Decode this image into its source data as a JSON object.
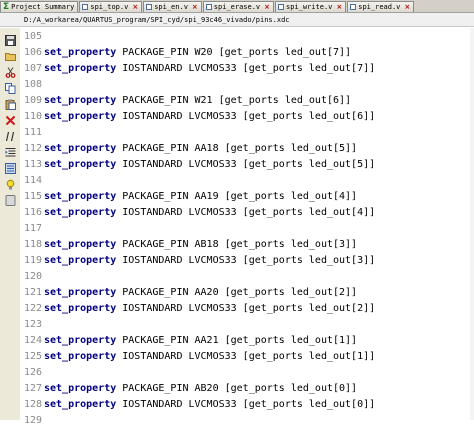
{
  "tabs": [
    {
      "label": "Project Summary",
      "icon": "sigma-icon"
    },
    {
      "label": "spi_top.v",
      "icon": "verilog-file-icon"
    },
    {
      "label": "spi_en.v",
      "icon": "verilog-file-icon"
    },
    {
      "label": "spi_erase.v",
      "icon": "verilog-file-icon"
    },
    {
      "label": "spi_write.v",
      "icon": "verilog-file-icon"
    },
    {
      "label": "spi_read.v",
      "icon": "verilog-file-icon"
    }
  ],
  "tab_close_glyph": "×",
  "file_path": "D:/A_workarea/QUARTUS_program/SPI_cyd/spi_93c46_vivado/pins.xdc",
  "toolbar_icons": [
    "save-icon",
    "open-folder-icon",
    "cut-icon",
    "copy-icon",
    "paste-icon",
    "delete-icon",
    "comment-icon",
    "indent-icon",
    "find-icon",
    "bookmark-icon",
    "insert-template-icon"
  ],
  "code_lines": [
    {
      "num": "105",
      "kw": "",
      "rest": ""
    },
    {
      "num": "106",
      "kw": "set_property",
      "rest": " PACKAGE_PIN W20 [get_ports led_out[7]]"
    },
    {
      "num": "107",
      "kw": "set_property",
      "rest": " IOSTANDARD LVCMOS33 [get_ports led_out[7]]"
    },
    {
      "num": "108",
      "kw": "",
      "rest": ""
    },
    {
      "num": "109",
      "kw": "set_property",
      "rest": " PACKAGE_PIN W21 [get_ports led_out[6]]"
    },
    {
      "num": "110",
      "kw": "set_property",
      "rest": " IOSTANDARD LVCMOS33 [get_ports led_out[6]]"
    },
    {
      "num": "111",
      "kw": "",
      "rest": ""
    },
    {
      "num": "112",
      "kw": "set_property",
      "rest": " PACKAGE_PIN AA18 [get_ports led_out[5]]"
    },
    {
      "num": "113",
      "kw": "set_property",
      "rest": " IOSTANDARD LVCMOS33 [get_ports led_out[5]]"
    },
    {
      "num": "114",
      "kw": "",
      "rest": ""
    },
    {
      "num": "115",
      "kw": "set_property",
      "rest": " PACKAGE_PIN AA19 [get_ports led_out[4]]"
    },
    {
      "num": "116",
      "kw": "set_property",
      "rest": " IOSTANDARD LVCMOS33 [get_ports led_out[4]]"
    },
    {
      "num": "117",
      "kw": "",
      "rest": ""
    },
    {
      "num": "118",
      "kw": "set_property",
      "rest": " PACKAGE_PIN AB18 [get_ports led_out[3]]"
    },
    {
      "num": "119",
      "kw": "set_property",
      "rest": " IOSTANDARD LVCMOS33 [get_ports led_out[3]]"
    },
    {
      "num": "120",
      "kw": "",
      "rest": ""
    },
    {
      "num": "121",
      "kw": "set_property",
      "rest": " PACKAGE_PIN AA20 [get_ports led_out[2]]"
    },
    {
      "num": "122",
      "kw": "set_property",
      "rest": " IOSTANDARD LVCMOS33 [get_ports led_out[2]]"
    },
    {
      "num": "123",
      "kw": "",
      "rest": ""
    },
    {
      "num": "124",
      "kw": "set_property",
      "rest": " PACKAGE_PIN AA21 [get_ports led_out[1]]"
    },
    {
      "num": "125",
      "kw": "set_property",
      "rest": " IOSTANDARD LVCMOS33 [get_ports led_out[1]]"
    },
    {
      "num": "126",
      "kw": "",
      "rest": ""
    },
    {
      "num": "127",
      "kw": "set_property",
      "rest": " PACKAGE_PIN AB20 [get_ports led_out[0]]"
    },
    {
      "num": "128",
      "kw": "set_property",
      "rest": " IOSTANDARD LVCMOS33 [get_ports led_out[0]]"
    },
    {
      "num": "129",
      "kw": "",
      "rest": ""
    }
  ]
}
